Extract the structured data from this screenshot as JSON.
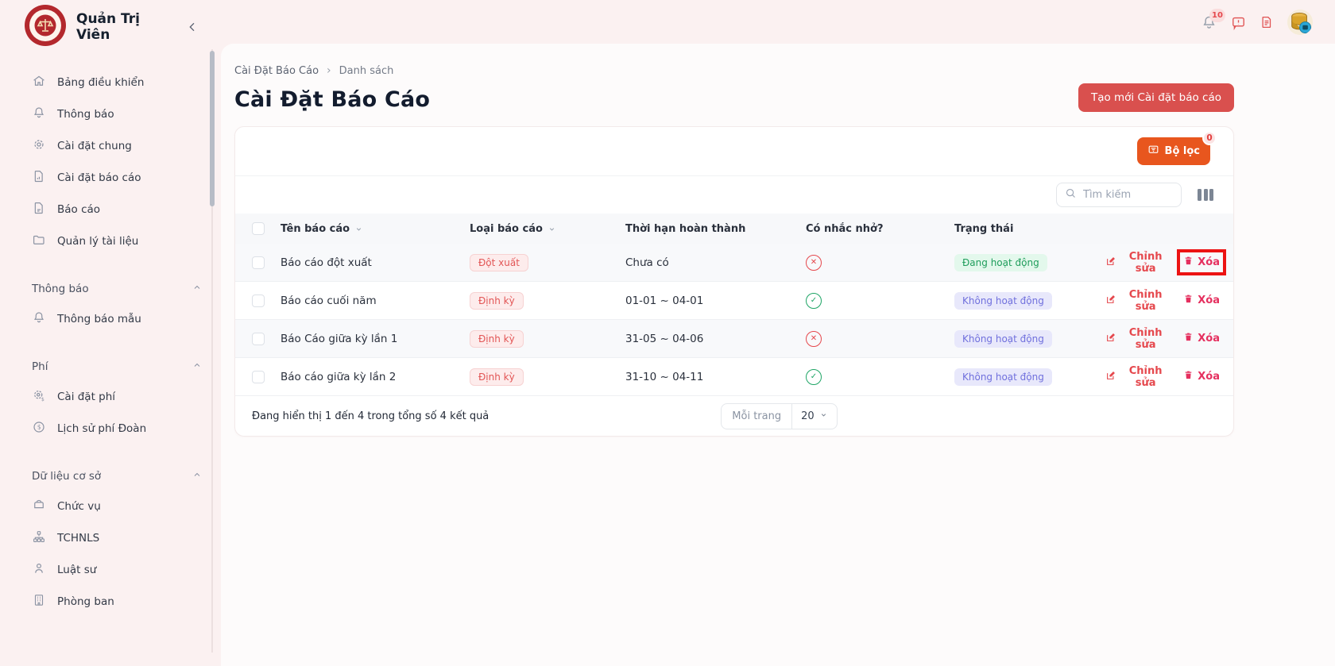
{
  "app": {
    "title": "Quản Trị Viên"
  },
  "header": {
    "notification_count": "10"
  },
  "sidebar": {
    "main_items": [
      {
        "label": "Bảng điều khiển",
        "icon": "home-icon"
      },
      {
        "label": "Thông báo",
        "icon": "bell-icon"
      },
      {
        "label": "Cài đặt chung",
        "icon": "gear-icon"
      },
      {
        "label": "Cài đặt báo cáo",
        "icon": "report-settings-icon"
      },
      {
        "label": "Báo cáo",
        "icon": "report-icon"
      },
      {
        "label": "Quản lý tài liệu",
        "icon": "folder-icon"
      }
    ],
    "groups": [
      {
        "title": "Thông báo",
        "items": [
          {
            "label": "Thông báo mẫu",
            "icon": "bell-icon"
          }
        ]
      },
      {
        "title": "Phí",
        "items": [
          {
            "label": "Cài đặt phí",
            "icon": "fee-settings-icon"
          },
          {
            "label": "Lịch sử phí Đoàn",
            "icon": "dollar-circle-icon"
          }
        ]
      },
      {
        "title": "Dữ liệu cơ sở",
        "items": [
          {
            "label": "Chức vụ",
            "icon": "briefcase-icon"
          },
          {
            "label": "TCHNLS",
            "icon": "org-chart-icon"
          },
          {
            "label": "Luật sư",
            "icon": "person-icon"
          },
          {
            "label": "Phòng ban",
            "icon": "building-icon"
          }
        ]
      }
    ]
  },
  "breadcrumb": {
    "items": [
      "Cài Đặt Báo Cáo",
      "Danh sách"
    ],
    "separator": "›"
  },
  "page": {
    "title": "Cài Đặt Báo Cáo",
    "create_button_label": "Tạo mới Cài đặt báo cáo"
  },
  "toolbar": {
    "filter_label": "Bộ lọc",
    "filter_badge": "0",
    "search_placeholder": "Tìm kiếm"
  },
  "table": {
    "headers": {
      "name": "Tên báo cáo",
      "type": "Loại báo cáo",
      "deadline": "Thời hạn hoàn thành",
      "reminder": "Có nhắc nhở?",
      "status": "Trạng thái"
    },
    "actions": {
      "edit_label": "Chỉnh sửa",
      "delete_label": "Xóa"
    },
    "rows": [
      {
        "name": "Báo cáo đột xuất",
        "type": "Đột xuất",
        "deadline": "Chưa có",
        "reminder_glyph": "✕",
        "reminder_variant": "no",
        "status": "Đang hoạt động",
        "status_variant": "active",
        "highlight": "true"
      },
      {
        "name": "Báo cáo cuối năm",
        "type": "Định kỳ",
        "deadline": "01-01 ~ 04-01",
        "reminder_glyph": "✓",
        "reminder_variant": "yes",
        "status": "Không hoạt động",
        "status_variant": "inactive",
        "highlight": "false"
      },
      {
        "name": "Báo Cáo giữa kỳ lần 1",
        "type": "Định kỳ",
        "deadline": "31-05 ~ 04-06",
        "reminder_glyph": "✕",
        "reminder_variant": "no",
        "status": "Không hoạt động",
        "status_variant": "inactive",
        "highlight": "false"
      },
      {
        "name": "Báo cáo giữa kỳ lần 2",
        "type": "Định kỳ",
        "deadline": "31-10 ~ 04-11",
        "reminder_glyph": "✓",
        "reminder_variant": "yes",
        "status": "Không hoạt động",
        "status_variant": "inactive",
        "highlight": "false"
      }
    ]
  },
  "pagination": {
    "summary": "Đang hiển thị 1 đến 4 trong tổng số 4 kết quả",
    "per_page_label": "Mỗi trang",
    "per_page_value": "20"
  },
  "colors": {
    "accent_red": "#d9504e",
    "accent_orange": "#e8561e",
    "status_active": "#1f9d5b",
    "status_inactive": "#7070dd",
    "danger": "#e5484d",
    "highlight_box": "#ec1313"
  }
}
